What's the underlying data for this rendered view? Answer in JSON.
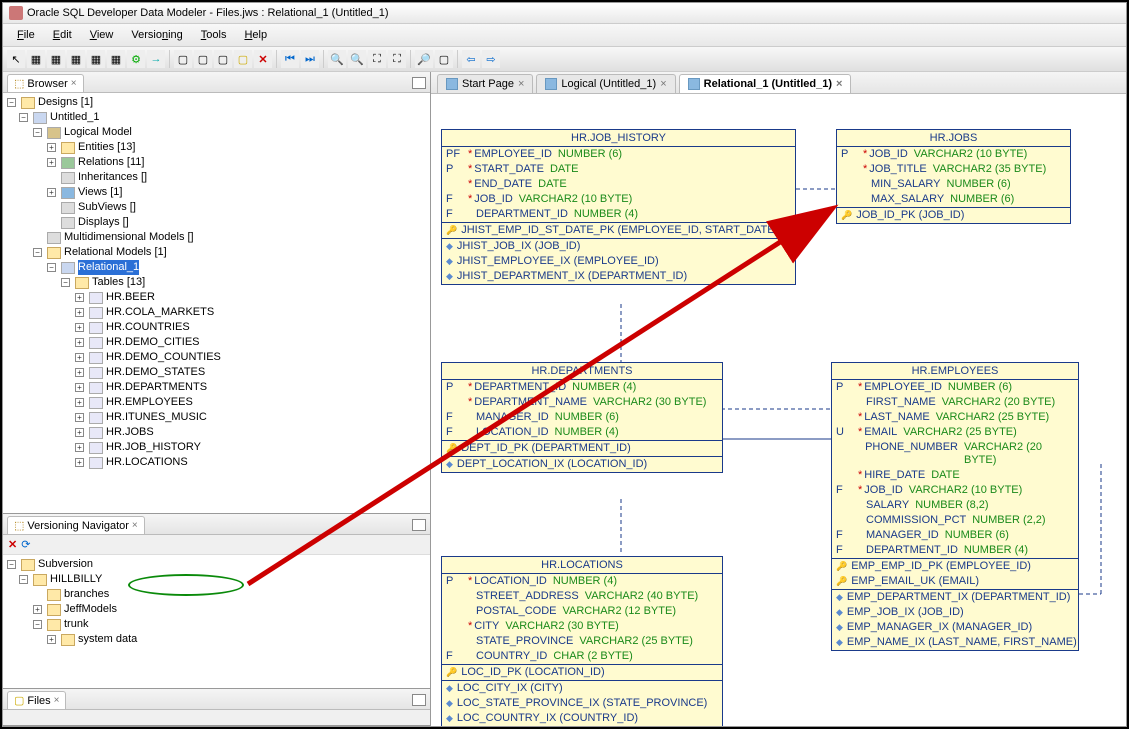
{
  "window": {
    "title": "Oracle SQL Developer Data Modeler - Files.jws : Relational_1 (Untitled_1)"
  },
  "menu": {
    "file": "File",
    "edit": "Edit",
    "view": "View",
    "versioning": "Versioning",
    "tools": "Tools",
    "help": "Help"
  },
  "panels": {
    "browser": "Browser",
    "versioning": "Versioning Navigator",
    "files": "Files"
  },
  "tree": {
    "designs": "Designs [1]",
    "untitled": "Untitled_1",
    "logical": "Logical Model",
    "entities": "Entities [13]",
    "relations": "Relations [11]",
    "inheritances": "Inheritances []",
    "views": "Views [1]",
    "subviews": "SubViews []",
    "displays": "Displays []",
    "multidim": "Multidimensional Models []",
    "relmodels": "Relational Models [1]",
    "rel1": "Relational_1",
    "tables": "Tables [13]",
    "t0": "HR.BEER",
    "t1": "HR.COLA_MARKETS",
    "t2": "HR.COUNTRIES",
    "t3": "HR.DEMO_CITIES",
    "t4": "HR.DEMO_COUNTIES",
    "t5": "HR.DEMO_STATES",
    "t6": "HR.DEPARTMENTS",
    "t7": "HR.EMPLOYEES",
    "t8": "HR.ITUNES_MUSIC",
    "t9": "HR.JOBS",
    "t10": "HR.JOB_HISTORY",
    "t11": "HR.LOCATIONS"
  },
  "versioning": {
    "subversion": "Subversion",
    "hillbilly": "HILLBILLY",
    "branches": "branches",
    "jeffmodels": "JeffModels",
    "trunk": "trunk",
    "systemdata": "system data"
  },
  "editor_tabs": {
    "start": "Start Page",
    "logical": "Logical (Untitled_1)",
    "relational": "Relational_1 (Untitled_1)"
  },
  "entities": {
    "job_history": {
      "title": "HR.JOB_HISTORY",
      "cols": [
        {
          "flag": "PF",
          "star": "*",
          "name": "EMPLOYEE_ID",
          "type": "NUMBER (6)"
        },
        {
          "flag": "P",
          "star": "*",
          "name": "START_DATE",
          "type": "DATE"
        },
        {
          "flag": "",
          "star": "*",
          "name": "END_DATE",
          "type": "DATE"
        },
        {
          "flag": "F",
          "star": "*",
          "name": "JOB_ID",
          "type": "VARCHAR2 (10 BYTE)"
        },
        {
          "flag": "F",
          "star": "",
          "name": "DEPARTMENT_ID",
          "type": "NUMBER (4)"
        }
      ],
      "pk": "JHIST_EMP_ID_ST_DATE_PK (EMPLOYEE_ID, START_DATE)",
      "idx": [
        "JHIST_JOB_IX (JOB_ID)",
        "JHIST_EMPLOYEE_IX (EMPLOYEE_ID)",
        "JHIST_DEPARTMENT_IX (DEPARTMENT_ID)"
      ]
    },
    "jobs": {
      "title": "HR.JOBS",
      "cols": [
        {
          "flag": "P",
          "star": "*",
          "name": "JOB_ID",
          "type": "VARCHAR2 (10 BYTE)"
        },
        {
          "flag": "",
          "star": "*",
          "name": "JOB_TITLE",
          "type": "VARCHAR2 (35 BYTE)"
        },
        {
          "flag": "",
          "star": "",
          "name": "MIN_SALARY",
          "type": "NUMBER (6)"
        },
        {
          "flag": "",
          "star": "",
          "name": "MAX_SALARY",
          "type": "NUMBER (6)"
        }
      ],
      "pk": "JOB_ID_PK (JOB_ID)"
    },
    "departments": {
      "title": "HR.DEPARTMENTS",
      "cols": [
        {
          "flag": "P",
          "star": "*",
          "name": "DEPARTMENT_ID",
          "type": "NUMBER (4)"
        },
        {
          "flag": "",
          "star": "*",
          "name": "DEPARTMENT_NAME",
          "type": "VARCHAR2 (30 BYTE)"
        },
        {
          "flag": "F",
          "star": "",
          "name": "MANAGER_ID",
          "type": "NUMBER (6)"
        },
        {
          "flag": "F",
          "star": "",
          "name": "LOCATION_ID",
          "type": "NUMBER (4)"
        }
      ],
      "pk": "DEPT_ID_PK (DEPARTMENT_ID)",
      "idx": [
        "DEPT_LOCATION_IX (LOCATION_ID)"
      ]
    },
    "employees": {
      "title": "HR.EMPLOYEES",
      "cols": [
        {
          "flag": "P",
          "star": "*",
          "name": "EMPLOYEE_ID",
          "type": "NUMBER (6)"
        },
        {
          "flag": "",
          "star": "",
          "name": "FIRST_NAME",
          "type": "VARCHAR2 (20 BYTE)"
        },
        {
          "flag": "",
          "star": "*",
          "name": "LAST_NAME",
          "type": "VARCHAR2 (25 BYTE)"
        },
        {
          "flag": "U",
          "star": "*",
          "name": "EMAIL",
          "type": "VARCHAR2 (25 BYTE)"
        },
        {
          "flag": "",
          "star": "",
          "name": "PHONE_NUMBER",
          "type": "VARCHAR2 (20 BYTE)"
        },
        {
          "flag": "",
          "star": "*",
          "name": "HIRE_DATE",
          "type": "DATE"
        },
        {
          "flag": "F",
          "star": "*",
          "name": "JOB_ID",
          "type": "VARCHAR2 (10 BYTE)"
        },
        {
          "flag": "",
          "star": "",
          "name": "SALARY",
          "type": "NUMBER (8,2)"
        },
        {
          "flag": "",
          "star": "",
          "name": "COMMISSION_PCT",
          "type": "NUMBER (2,2)"
        },
        {
          "flag": "F",
          "star": "",
          "name": "MANAGER_ID",
          "type": "NUMBER (6)"
        },
        {
          "flag": "F",
          "star": "",
          "name": "DEPARTMENT_ID",
          "type": "NUMBER (4)"
        }
      ],
      "pk": "EMP_EMP_ID_PK (EMPLOYEE_ID)",
      "uk": "EMP_EMAIL_UK (EMAIL)",
      "idx": [
        "EMP_DEPARTMENT_IX (DEPARTMENT_ID)",
        "EMP_JOB_IX (JOB_ID)",
        "EMP_MANAGER_IX (MANAGER_ID)",
        "EMP_NAME_IX (LAST_NAME, FIRST_NAME)"
      ]
    },
    "locations": {
      "title": "HR.LOCATIONS",
      "cols": [
        {
          "flag": "P",
          "star": "*",
          "name": "LOCATION_ID",
          "type": "NUMBER (4)"
        },
        {
          "flag": "",
          "star": "",
          "name": "STREET_ADDRESS",
          "type": "VARCHAR2 (40 BYTE)"
        },
        {
          "flag": "",
          "star": "",
          "name": "POSTAL_CODE",
          "type": "VARCHAR2 (12 BYTE)"
        },
        {
          "flag": "",
          "star": "*",
          "name": "CITY",
          "type": "VARCHAR2 (30 BYTE)"
        },
        {
          "flag": "",
          "star": "",
          "name": "STATE_PROVINCE",
          "type": "VARCHAR2 (25 BYTE)"
        },
        {
          "flag": "F",
          "star": "",
          "name": "COUNTRY_ID",
          "type": "CHAR (2 BYTE)"
        }
      ],
      "pk": "LOC_ID_PK (LOCATION_ID)",
      "idx": [
        "LOC_CITY_IX (CITY)",
        "LOC_STATE_PROVINCE_IX (STATE_PROVINCE)",
        "LOC_COUNTRY_IX (COUNTRY_ID)"
      ]
    }
  }
}
